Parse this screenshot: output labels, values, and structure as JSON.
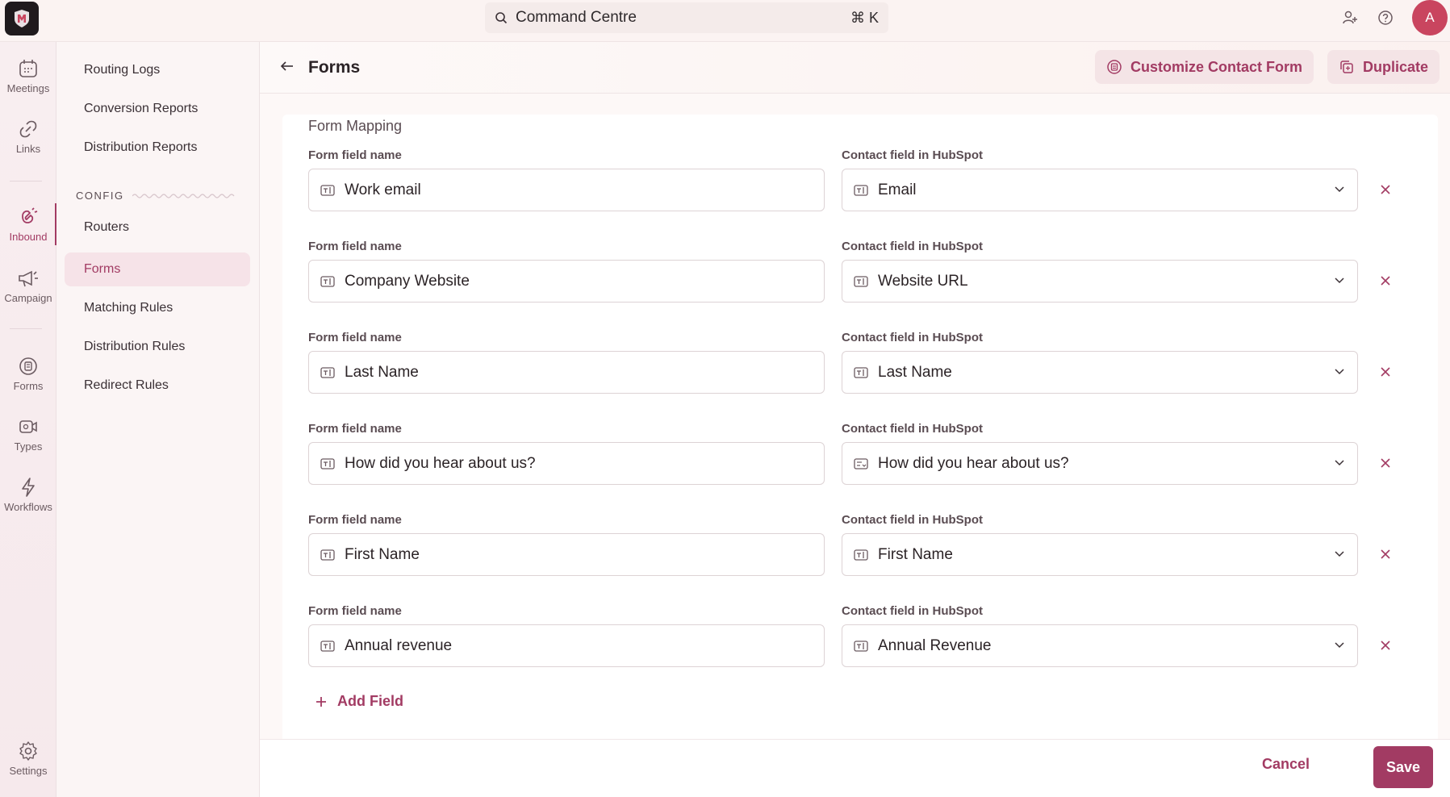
{
  "topbar": {
    "search_label": "Command Centre",
    "shortcut": "⌘ K",
    "avatar_initial": "A"
  },
  "rail": {
    "items": [
      {
        "label": "Meetings",
        "icon": "calendar-icon"
      },
      {
        "label": "Links",
        "icon": "link-icon"
      },
      {
        "label": "Inbound",
        "icon": "magnet-icon"
      },
      {
        "label": "Campaign",
        "icon": "megaphone-icon"
      },
      {
        "label": "Forms",
        "icon": "form-icon"
      },
      {
        "label": "Types",
        "icon": "video-icon"
      },
      {
        "label": "Workflows",
        "icon": "bolt-icon"
      },
      {
        "label": "Settings",
        "icon": "gear-icon"
      }
    ]
  },
  "sidebar": {
    "items": [
      {
        "label": "Routing Logs"
      },
      {
        "label": "Conversion Reports"
      },
      {
        "label": "Distribution Reports"
      }
    ],
    "config_heading": "CONFIG",
    "config_items": [
      {
        "label": "Routers"
      },
      {
        "label": "Forms"
      },
      {
        "label": "Matching Rules"
      },
      {
        "label": "Distribution Rules"
      },
      {
        "label": "Redirect Rules"
      }
    ]
  },
  "header": {
    "title": "Forms",
    "customize_label": "Customize Contact Form",
    "duplicate_label": "Duplicate"
  },
  "mapping": {
    "section_title": "Form Mapping",
    "form_field_label": "Form field name",
    "contact_field_label": "Contact field in HubSpot",
    "rows": [
      {
        "form_field": "Work email",
        "contact_field": "Email"
      },
      {
        "form_field": "Company Website",
        "contact_field": "Website URL"
      },
      {
        "form_field": "Last Name",
        "contact_field": "Last Name"
      },
      {
        "form_field": "How did you hear about us?",
        "contact_field": "How did you hear about us?"
      },
      {
        "form_field": "First Name",
        "contact_field": "First Name"
      },
      {
        "form_field": "Annual revenue",
        "contact_field": "Annual Revenue"
      }
    ],
    "add_field_label": "Add Field"
  },
  "footer": {
    "cancel_label": "Cancel",
    "save_label": "Save"
  },
  "colors": {
    "accent": "#a23b63",
    "avatar": "#c9455f"
  }
}
